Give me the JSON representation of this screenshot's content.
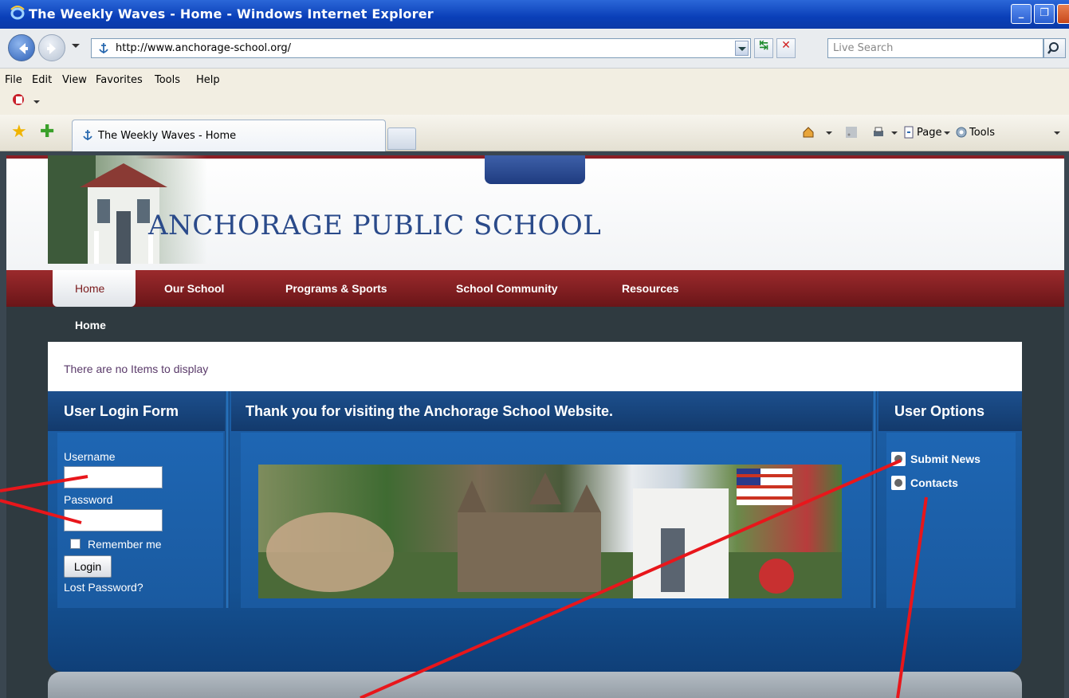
{
  "browser": {
    "window_title": "The Weekly Waves - Home - Windows Internet Explorer",
    "url": "http://www.anchorage-school.org/",
    "search_placeholder": "Live Search",
    "menu": [
      "File",
      "Edit",
      "View",
      "Favorites",
      "Tools",
      "Help"
    ],
    "tab_title": "The Weekly Waves - Home",
    "commands": {
      "page": "Page",
      "tools": "Tools"
    }
  },
  "site": {
    "school_name": "ANCHORAGE PUBLIC SCHOOL",
    "nav": [
      "Home",
      "Our School",
      "Programs & Sports",
      "School Community",
      "Resources"
    ],
    "breadcrumb": "Home",
    "no_items_message": "There are no Items to display"
  },
  "login": {
    "heading": "User Login Form",
    "username_label": "Username",
    "password_label": "Password",
    "remember_label": "Remember me",
    "login_button": "Login",
    "lost_password": "Lost Password?"
  },
  "welcome": {
    "heading": "Thank you for visiting the Anchorage School Website."
  },
  "options": {
    "heading": "User Options",
    "items": [
      "Submit News",
      "Contacts"
    ]
  },
  "colors": {
    "nav_red": "#8b1e24",
    "panel_blue": "#1a5aa0",
    "annotation_red": "#e8161b",
    "school_name_blue": "#2a4a8a"
  }
}
